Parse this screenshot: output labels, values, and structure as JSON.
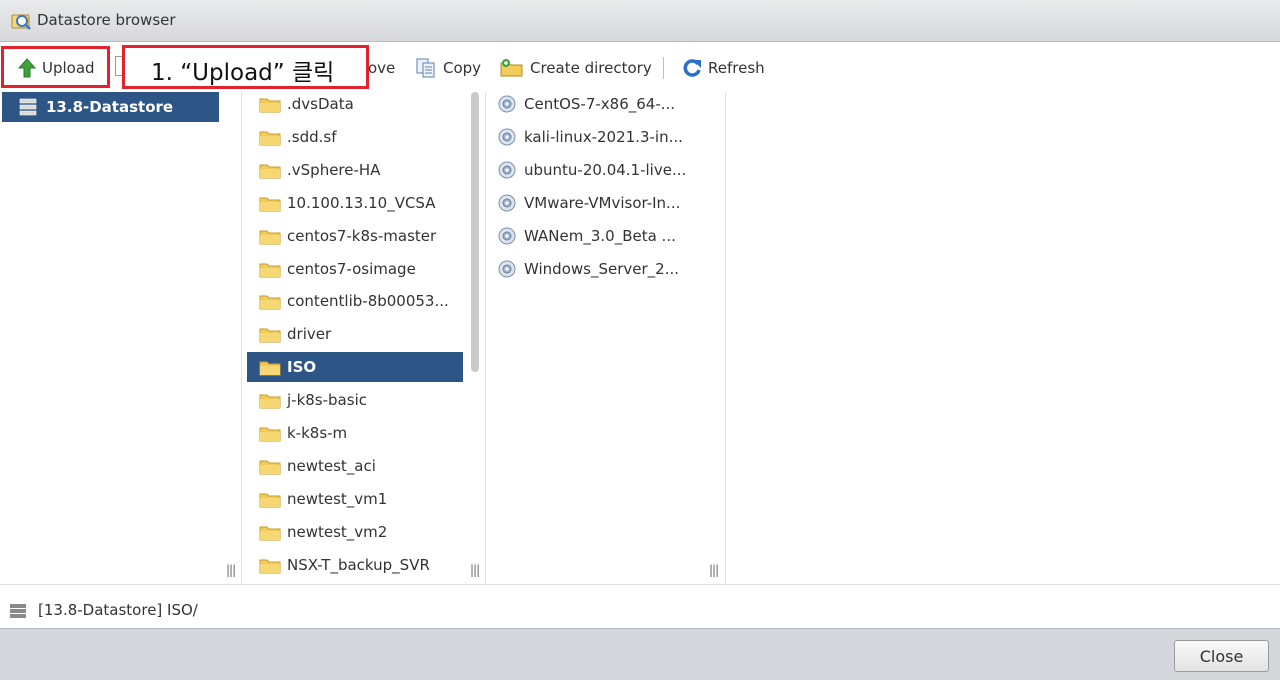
{
  "window": {
    "title": "Datastore browser"
  },
  "toolbar": {
    "upload_label": "Upload",
    "move_label": "ove",
    "copy_label": "Copy",
    "create_directory_label": "Create directory",
    "refresh_label": "Refresh"
  },
  "annotation": {
    "callout_text": "1. “Upload” 클릭",
    "color": "#e0232d"
  },
  "datastores": [
    {
      "label": "13.8-Datastore",
      "selected": true
    }
  ],
  "folders": [
    {
      "label": ".dvsData"
    },
    {
      "label": ".sdd.sf"
    },
    {
      "label": ".vSphere-HA"
    },
    {
      "label": "10.100.13.10_VCSA"
    },
    {
      "label": "centos7-k8s-master"
    },
    {
      "label": "centos7-osimage"
    },
    {
      "label": "contentlib-8b00053..."
    },
    {
      "label": "driver"
    },
    {
      "label": "ISO",
      "selected": true
    },
    {
      "label": "j-k8s-basic"
    },
    {
      "label": "k-k8s-m"
    },
    {
      "label": "newtest_aci"
    },
    {
      "label": "newtest_vm1"
    },
    {
      "label": "newtest_vm2"
    },
    {
      "label": "NSX-T_backup_SVR"
    }
  ],
  "files": [
    {
      "label": "CentOS-7-x86_64-..."
    },
    {
      "label": "kali-linux-2021.3-in..."
    },
    {
      "label": "ubuntu-20.04.1-live..."
    },
    {
      "label": "VMware-VMvisor-In..."
    },
    {
      "label": "WANem_3.0_Beta ..."
    },
    {
      "label": "Windows_Server_2..."
    }
  ],
  "path_bar": {
    "text": "[13.8-Datastore] ISO/"
  },
  "footer": {
    "close_label": "Close"
  },
  "colors": {
    "selection": "#2d5585",
    "accent": "#2a6fcb",
    "footer_bg": "#d3d6db"
  }
}
